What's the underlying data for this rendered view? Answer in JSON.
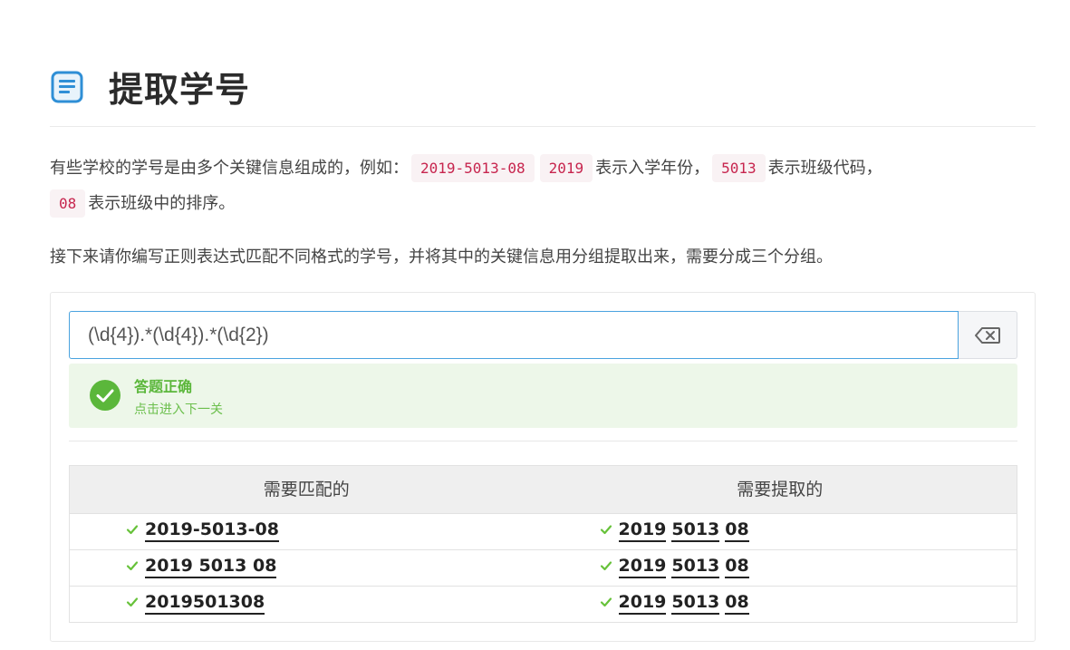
{
  "header": {
    "title": "提取学号",
    "icon": "document-icon"
  },
  "intro": {
    "p1_a": "有些学校的学号是由多个关键信息组成的，例如：",
    "code_full": "2019-5013-08",
    "code_year": "2019",
    "p1_b": "表示入学年份，",
    "code_class": "5013",
    "p1_c": "表示班级代码，",
    "code_rank": "08",
    "p1_d": "表示班级中的排序。",
    "p2": "接下来请你编写正则表达式匹配不同格式的学号，并将其中的关键信息用分组提取出来，需要分成三个分组。"
  },
  "regex": {
    "value": "(\\d{4}).*(\\d{4}).*(\\d{2})",
    "clear_icon": "backspace-icon"
  },
  "feedback": {
    "title": "答题正确",
    "next": "点击进入下一关",
    "color": "#5bb73b"
  },
  "table": {
    "col_match": "需要匹配的",
    "col_extract": "需要提取的",
    "rows": [
      {
        "match": "2019-5013-08",
        "groups": [
          "2019",
          "5013",
          "08"
        ]
      },
      {
        "match": "2019 5013 08",
        "groups": [
          "2019",
          "5013",
          "08"
        ]
      },
      {
        "match": "2019501308",
        "groups": [
          "2019",
          "5013",
          "08"
        ]
      }
    ]
  }
}
